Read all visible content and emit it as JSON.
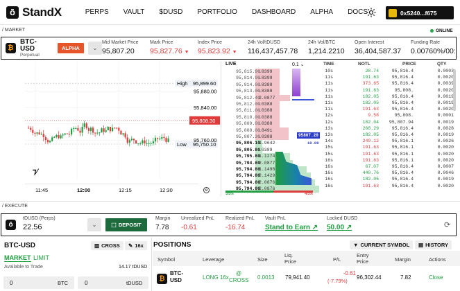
{
  "brand": {
    "name": "StandX"
  },
  "nav": {
    "items": [
      "PERPS",
      "VAULT",
      "$DUSD",
      "PORTFOLIO",
      "DASHBOARD",
      "ALPHA",
      "DOCS"
    ],
    "wallet": "0x5240...f675"
  },
  "sections": {
    "market": "/ MARKET",
    "execute": "/ EXECUTE",
    "online": "ONLINE"
  },
  "market": {
    "symbol": "BTC-USD",
    "type": "Perpetual",
    "badge": "ALPHA",
    "stats": [
      {
        "label": "Mid Market Price",
        "value": "95,807.20",
        "color": "#111"
      },
      {
        "label": "Mark Price",
        "value": "95,827.76",
        "color": "#e03a3a",
        "arrow": true
      },
      {
        "label": "Index Price",
        "value": "95,823.92",
        "color": "#e03a3a",
        "arrow": true
      },
      {
        "label": "24h Vol/tDUSD",
        "value": "116,437,457.78",
        "color": "#111"
      },
      {
        "label": "24h Vol/BTC",
        "value": "1,214.2210",
        "color": "#111"
      },
      {
        "label": "Open Interest",
        "value": "36,404,587.37",
        "color": "#111"
      },
      {
        "label": "Funding Rate",
        "value": "0.00760%/00:",
        "color": "#111"
      }
    ]
  },
  "chart": {
    "high_label": "High",
    "high_value": "95,899.60",
    "low_label": "Low",
    "low_value": "95,750.10",
    "price_ticks": [
      "95,880.00",
      "95,840.00",
      "95,760.00"
    ],
    "current": "95,808.30",
    "time_ticks": [
      "11:45",
      "12:00",
      "12:15",
      "12:30"
    ],
    "tv_logo": "17"
  },
  "orderbook": {
    "live_label": "LIVE",
    "step": "0.1",
    "asks": [
      "95,815.90",
      "95,814.90",
      "95,814.00",
      "95,813.00",
      "95,812.40",
      "95,812.00",
      "95,811.00",
      "95,810.00",
      "95,809.00",
      "95,808.00",
      "95,807.30"
    ],
    "ask_sizes": [
      ".8399",
      ".8399",
      ".8388",
      ".8388",
      "2.0877",
      ".0388",
      ".0388",
      ".0388",
      ".0388",
      ".8491",
      ".0388"
    ],
    "mid": "95807.20",
    "mid_sub": "10.00",
    "bids": [
      "95,806.10",
      "95,805.80",
      "95,795.80",
      "95,794.80",
      "95,794.80",
      "95,794.80",
      "95,794.80",
      "95,794.80"
    ],
    "bid_sizes": [
      "1.9642",
      ".0389",
      "1.1274",
      "2.0877",
      "1.1498",
      "2.1429",
      "2.0876",
      "2.0876"
    ],
    "buy_pct": "55%",
    "sell_pct": "45%"
  },
  "trades": {
    "headers": [
      "TIME",
      "NOTL",
      "PRICE",
      "QTY"
    ],
    "rows": [
      [
        "10s",
        "28.74",
        "95,816.4",
        "0.0003",
        "g"
      ],
      [
        "11s",
        "191.63",
        "95,816.4",
        "0.0020",
        "g"
      ],
      [
        "11s",
        "373.65",
        "95,816.4",
        "0.0039",
        "r"
      ],
      [
        "11s",
        "191.63",
        "95,808.",
        "0.0020",
        "g"
      ],
      [
        "11s",
        "182.05",
        "95,816.4",
        "0.0019",
        "g"
      ],
      [
        "11s",
        "182.05",
        "95,816.4",
        "0.0019",
        "g"
      ],
      [
        "11s",
        "191.63",
        "95,816.4",
        "0.0020",
        "r"
      ],
      [
        "12s",
        "9.58",
        "95,808.",
        "0.0001",
        "r"
      ],
      [
        "12s",
        "182.04",
        "95,807.94",
        "0.0019",
        "g"
      ],
      [
        "13s",
        "268.29",
        "95,816.4",
        "0.0028",
        "g"
      ],
      [
        "13s",
        "182.05",
        "95,816.4",
        "0.0019",
        "g"
      ],
      [
        "14s",
        "249.12",
        "95,816.1",
        "0.0026",
        "r"
      ],
      [
        "15s",
        "191.63",
        "95,816.1",
        "0.0020",
        "r"
      ],
      [
        "15s",
        "191.63",
        "95,816.1",
        "0.0020",
        "r"
      ],
      [
        "16s",
        "191.63",
        "95,816.1",
        "0.0020",
        "r"
      ],
      [
        "16s",
        "67.07",
        "95,816.4",
        "0.0007",
        "g"
      ],
      [
        "16s",
        "440.76",
        "95,816.4",
        "0.0046",
        "g"
      ],
      [
        "16s",
        "182.05",
        "95,816.4",
        "0.0019",
        "g"
      ],
      [
        "16s",
        "191.63",
        "95,816.4",
        "0.0020",
        "r"
      ]
    ]
  },
  "execute": {
    "account_label": "tDUSD (Perps)",
    "balance": "22.56",
    "deposit": "DEPOSIT",
    "stats": [
      {
        "label": "Margin",
        "value": "7.78",
        "color": "#111"
      },
      {
        "label": "Unrealized PnL",
        "value": "-0.61",
        "color": "#e03a3a"
      },
      {
        "label": "Realized PnL",
        "value": "-16.74",
        "color": "#e03a3a"
      },
      {
        "label": "Vault PnL",
        "value": "Stand to Earn",
        "color": "#1f9d3f"
      },
      {
        "label": "Locked DUSD",
        "value": "50.00",
        "color": "#1f9d3f"
      }
    ]
  },
  "order": {
    "symbol": "BTC-USD",
    "margin_mode": "CROSS",
    "leverage": "16x",
    "tab_market": "MARKET",
    "tab_limit": "LIMIT",
    "available_label": "Available to Trade",
    "available_value": "14.17 tDUSD",
    "qty_value": "0",
    "qty_unit": "BTC",
    "cost_value": "0",
    "cost_unit": "tDUSD"
  },
  "positions": {
    "title": "POSITIONS",
    "current_symbol": "CURRENT SYMBOL",
    "history": "HISTORY",
    "headers": [
      "Symbol",
      "Leverage",
      "Size",
      "Liq. Price",
      "P/L",
      "Entry Price",
      "Margin",
      "Actions"
    ],
    "row": {
      "symbol": "BTC-USD",
      "leverage": "LONG 16x",
      "mode": "@ CROSS",
      "size": "0.0013",
      "liq": "79,941.40",
      "pl": "-0.61",
      "pl_pct": "(-7.79%)",
      "entry": "96,302.44",
      "margin": "7.82",
      "action": "Close"
    }
  },
  "colors": {
    "up": "#1f9d3f",
    "down": "#e03a3a",
    "accent": "#e8542a",
    "brand_dark": "#111111"
  }
}
